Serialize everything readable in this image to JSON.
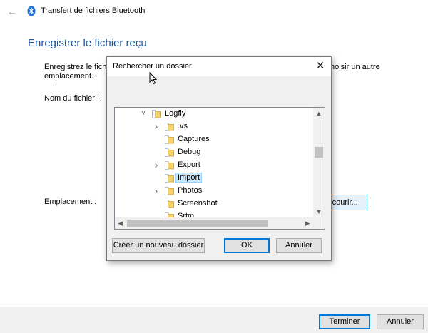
{
  "window": {
    "title": "Transfert de fichiers Bluetooth",
    "heading": "Enregistrer le fichier reçu",
    "intro_left": "Enregistrez le fichi",
    "intro_left_line2": "emplacement.",
    "intro_right": "hoisir un autre",
    "filename_label": "Nom du fichier :",
    "location_label": "Emplacement :",
    "browse_label": "rcourir...",
    "finish_label": "Terminer",
    "cancel_label": "Annuler"
  },
  "dialog": {
    "title": "Rechercher un dossier",
    "new_folder_label": "Créer un nouveau dossier",
    "ok_label": "OK",
    "cancel_label": "Annuler",
    "tree": [
      {
        "label": "Logfly",
        "expander": "expanded",
        "level": 0
      },
      {
        "label": ".vs",
        "expander": "collapsed",
        "level": 1
      },
      {
        "label": "Captures",
        "expander": "none",
        "level": 1
      },
      {
        "label": "Debug",
        "expander": "none",
        "level": 1
      },
      {
        "label": "Export",
        "expander": "collapsed",
        "level": 1
      },
      {
        "label": "Import",
        "expander": "none",
        "level": 1,
        "selected": true
      },
      {
        "label": "Photos",
        "expander": "collapsed",
        "level": 1
      },
      {
        "label": "Screenshot",
        "expander": "none",
        "level": 1
      },
      {
        "label": "Srtm",
        "expander": "none",
        "level": 1
      }
    ]
  },
  "colors": {
    "heading": "#1e55a0",
    "accent": "#0078d7",
    "selection": "#cce8ff",
    "folder": "#f6d36b"
  }
}
